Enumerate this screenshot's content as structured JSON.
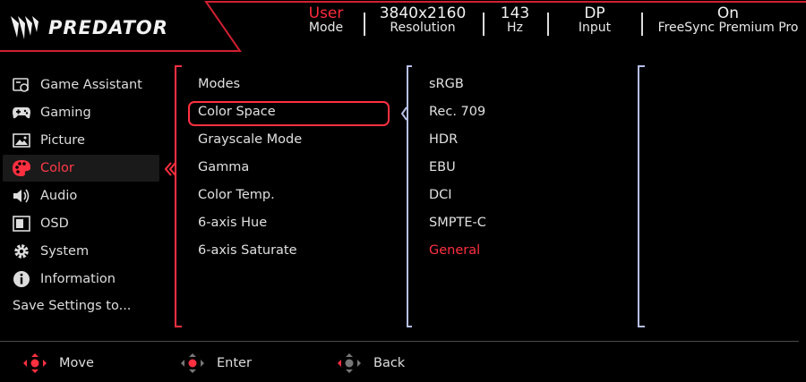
{
  "brand": {
    "name": "PREDATOR",
    "accent": "#ff3040"
  },
  "status": [
    {
      "value": "User",
      "label": "Mode",
      "highlight": true
    },
    {
      "value": "3840x2160",
      "label": "Resolution"
    },
    {
      "value": "143",
      "label": "Hz"
    },
    {
      "value": "DP",
      "label": "Input"
    },
    {
      "value": "On",
      "label": "FreeSync Premium Pro"
    }
  ],
  "menu": {
    "items": [
      {
        "label": "Game Assistant",
        "icon": "game-assistant-icon"
      },
      {
        "label": "Gaming",
        "icon": "gamepad-icon"
      },
      {
        "label": "Picture",
        "icon": "picture-icon"
      },
      {
        "label": "Color",
        "icon": "palette-icon",
        "active": true
      },
      {
        "label": "Audio",
        "icon": "speaker-icon"
      },
      {
        "label": "OSD",
        "icon": "osd-icon"
      },
      {
        "label": "System",
        "icon": "gear-icon"
      },
      {
        "label": "Information",
        "icon": "info-icon"
      }
    ],
    "save_label": "Save Settings to..."
  },
  "submenu": {
    "items": [
      "Modes",
      "Color Space",
      "Grayscale Mode",
      "Gamma",
      "Color Temp.",
      "6-axis Hue",
      "6-axis Saturate"
    ],
    "selected": "Color Space"
  },
  "options": {
    "items": [
      "sRGB",
      "Rec. 709",
      "HDR",
      "EBU",
      "DCI",
      "SMPTE-C",
      "General"
    ],
    "current": "General"
  },
  "footer": {
    "move_label": "Move",
    "enter_label": "Enter",
    "back_label": "Back"
  }
}
